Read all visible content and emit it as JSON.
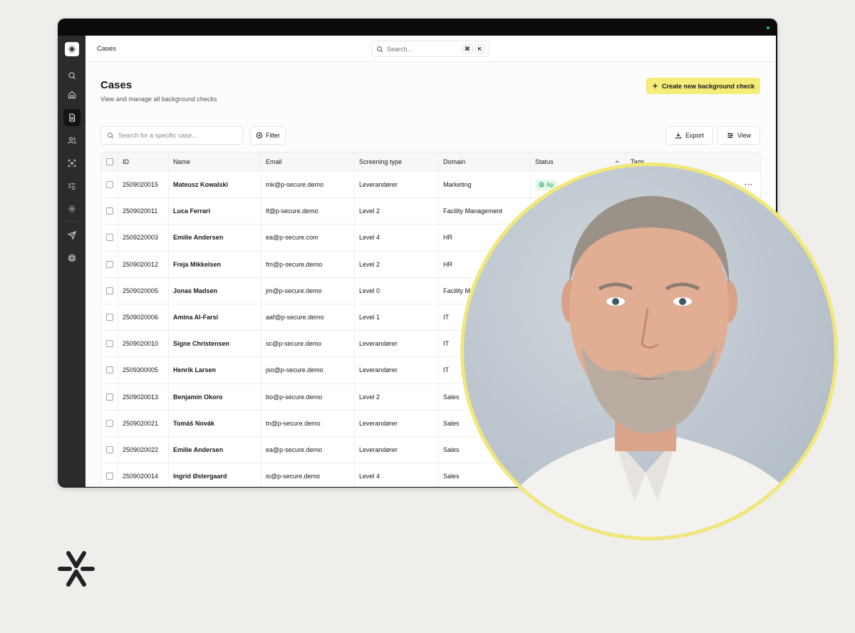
{
  "topbar": {
    "breadcrumb": "Cases",
    "search_placeholder": "Search...",
    "shortcut_mod": "⌘",
    "shortcut_key": "K"
  },
  "page": {
    "title": "Cases",
    "subtitle": "View and manage all background checks",
    "create_label": "Create new background check"
  },
  "toolbar": {
    "case_search_placeholder": "Search for a specific case...",
    "filter_label": "Filter",
    "export_label": "Export",
    "view_label": "View"
  },
  "table": {
    "columns": [
      "ID",
      "Name",
      "Email",
      "Screening type",
      "Domain",
      "Status",
      "Tags"
    ],
    "status_visible": "Ap",
    "rows": [
      {
        "id": "2509020015",
        "name": "Mateusz Kowalski",
        "email": "mk@p-secure.demo",
        "type": "Leverandører",
        "domain": "Marketing"
      },
      {
        "id": "2509020011",
        "name": "Luca Ferrari",
        "email": "lf@p-secure.demo",
        "type": "Level 2",
        "domain": "Facility Management"
      },
      {
        "id": "2509220003",
        "name": "Emilie Andersen",
        "email": "ea@p-secure.com",
        "type": "Level 4",
        "domain": "HR"
      },
      {
        "id": "2509020012",
        "name": "Freja Mikkelsen",
        "email": "fm@p-secure.demo",
        "type": "Level 2",
        "domain": "HR"
      },
      {
        "id": "2509020005",
        "name": "Jonas Madsen",
        "email": "jm@p-secure.demo",
        "type": "Level 0",
        "domain": "Facility M"
      },
      {
        "id": "2509020006",
        "name": "Amina Al-Farsi",
        "email": "aaf@p-secure.demo",
        "type": "Level 1",
        "domain": "IT"
      },
      {
        "id": "2509020010",
        "name": "Signe Christensen",
        "email": "sc@p-secure.demo",
        "type": "Leverandører",
        "domain": "IT"
      },
      {
        "id": "2509300005",
        "name": "Henrik Larsen",
        "email": "jso@p-secure.demo",
        "type": "Leverandører",
        "domain": "IT"
      },
      {
        "id": "2509020013",
        "name": "Benjamin Okoro",
        "email": "bo@p-secure.demo",
        "type": "Level 2",
        "domain": "Sales"
      },
      {
        "id": "2509020021",
        "name": "Tomáš Novák",
        "email": "tn@p-secure.demo",
        "type": "Leverandører",
        "domain": "Sales"
      },
      {
        "id": "2509020022",
        "name": "Emilie Andersen",
        "email": "ea@p-secure.demo",
        "type": "Leverandører",
        "domain": "Sales"
      },
      {
        "id": "2509020014",
        "name": "Ingrid Østergaard",
        "email": "io@p-secure.demo",
        "type": "Level 4",
        "domain": "Sales"
      }
    ]
  },
  "sidebar": {
    "icons": [
      "search-icon",
      "home-icon",
      "document-icon",
      "users-icon",
      "scan-icon",
      "checklist-icon",
      "gear-icon",
      "send-icon",
      "support-icon"
    ],
    "active": "document-icon"
  },
  "colors": {
    "accent_yellow": "#f5ec7a",
    "portrait_ring": "#f1e77a",
    "sidebar_bg": "#2b2b2b",
    "status_green": "#16a34a",
    "page_bg": "#efeeeb"
  }
}
